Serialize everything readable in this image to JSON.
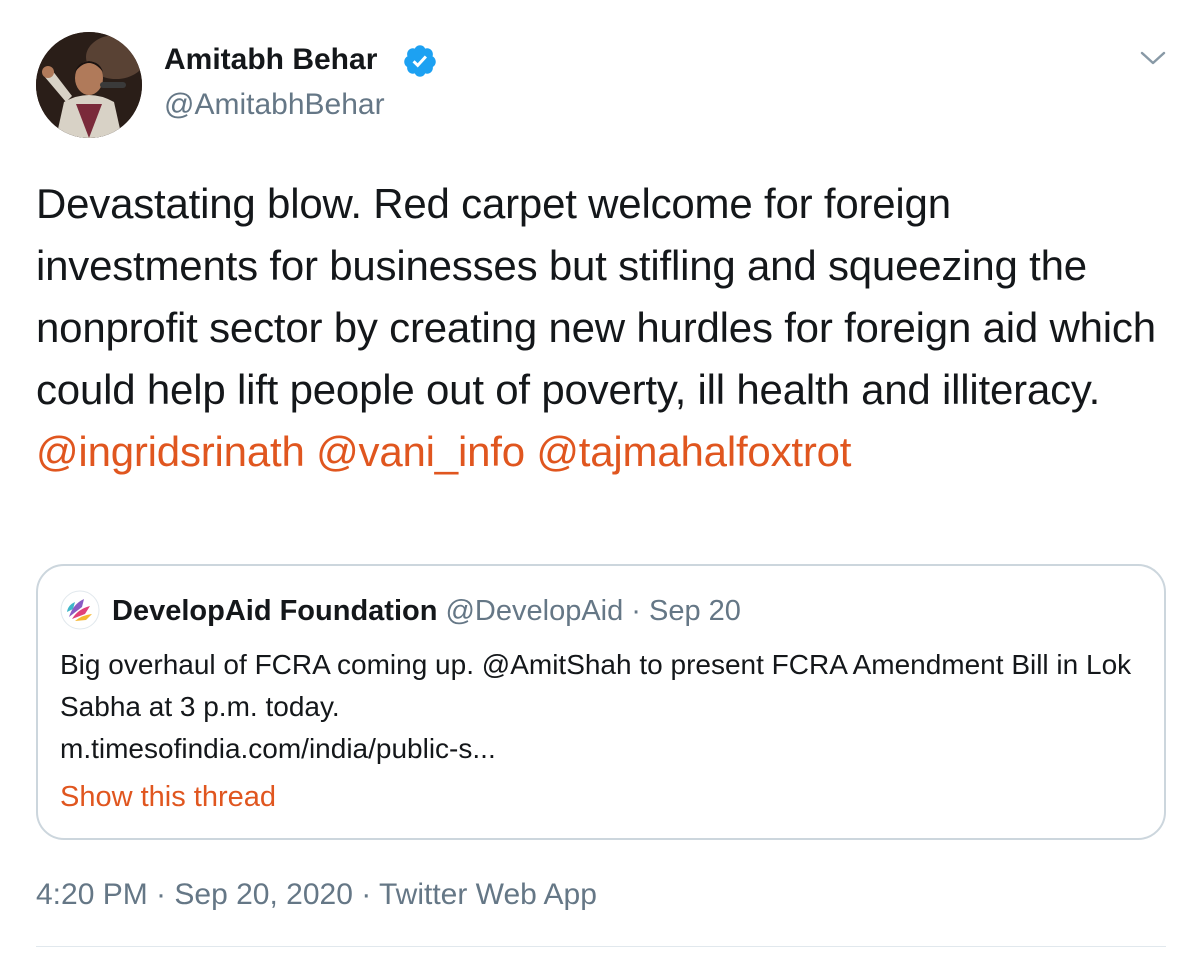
{
  "author": {
    "name": "Amitabh Behar",
    "handle": "@AmitabhBehar",
    "verified": true
  },
  "tweet": {
    "text_parts": [
      "Devastating blow. Red carpet welcome for foreign investments for businesses but stifling and squeezing the nonprofit sector by creating new hurdles for foreign aid which could help lift people out of poverty, ill health and illiteracy. ",
      "@ingridsrinath",
      " ",
      "@vani_info",
      " ",
      "@tajmahalfoxtrot"
    ]
  },
  "quote": {
    "name": "DevelopAid Foundation",
    "handle_date": " @DevelopAid · Sep 20",
    "text": "Big overhaul of FCRA coming up. @AmitShah to present FCRA Amendment Bill in Lok Sabha at 3 p.m. today.",
    "link": "m.timesofindia.com/india/public-s...",
    "show_thread": "Show this thread"
  },
  "meta": {
    "timestamp": "4:20 PM · Sep 20, 2020 · Twitter Web App"
  },
  "colors": {
    "accent": "#e0561f",
    "verified": "#1da1f2",
    "secondary_text": "#657786",
    "border": "#ccd6dd"
  },
  "icons": {
    "verified": "verified-badge-icon",
    "caret": "chevron-down-icon",
    "quote_avatar": "developaid-logo-icon"
  }
}
